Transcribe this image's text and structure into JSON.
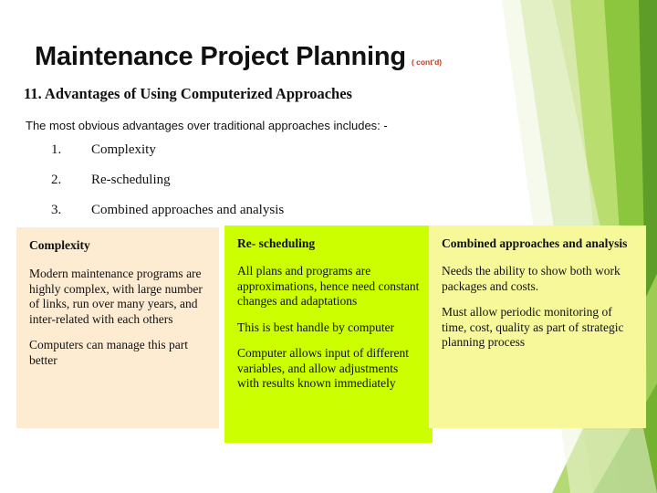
{
  "slide": {
    "title": "Maintenance Project Planning",
    "title_superscript": "( cont'd)",
    "subheading": "11. Advantages of Using Computerized Approaches",
    "intro": "The most obvious advantages over traditional approaches includes: -",
    "numbered_list": [
      {
        "number": "1.",
        "text": "Complexity"
      },
      {
        "number": "2.",
        "text": "Re-scheduling"
      },
      {
        "number": "3.",
        "text": "Combined approaches and analysis"
      }
    ],
    "boxes": [
      {
        "name": "complexity",
        "heading": "Complexity",
        "color": "#fdebd2",
        "paragraphs": [
          "Modern maintenance programs are highly complex, with large number of links, run over many years, and inter-related with each others",
          "Computers can manage this part better"
        ]
      },
      {
        "name": "re-scheduling",
        "heading": "Re- scheduling",
        "color": "#ccff00",
        "paragraphs": [
          "All plans and programs are approximations, hence need constant changes and adaptations",
          "This is best handle by computer",
          "Computer allows input of different variables, and allow adjustments with results known immediately"
        ]
      },
      {
        "name": "combined-approaches",
        "heading": "Combined approaches and analysis",
        "color": "#f6f89a",
        "paragraphs": [
          "Needs the ability to show both work packages and costs.",
          "Must allow periodic monitoring of time, cost, quality as part of strategic planning process"
        ]
      }
    ]
  }
}
